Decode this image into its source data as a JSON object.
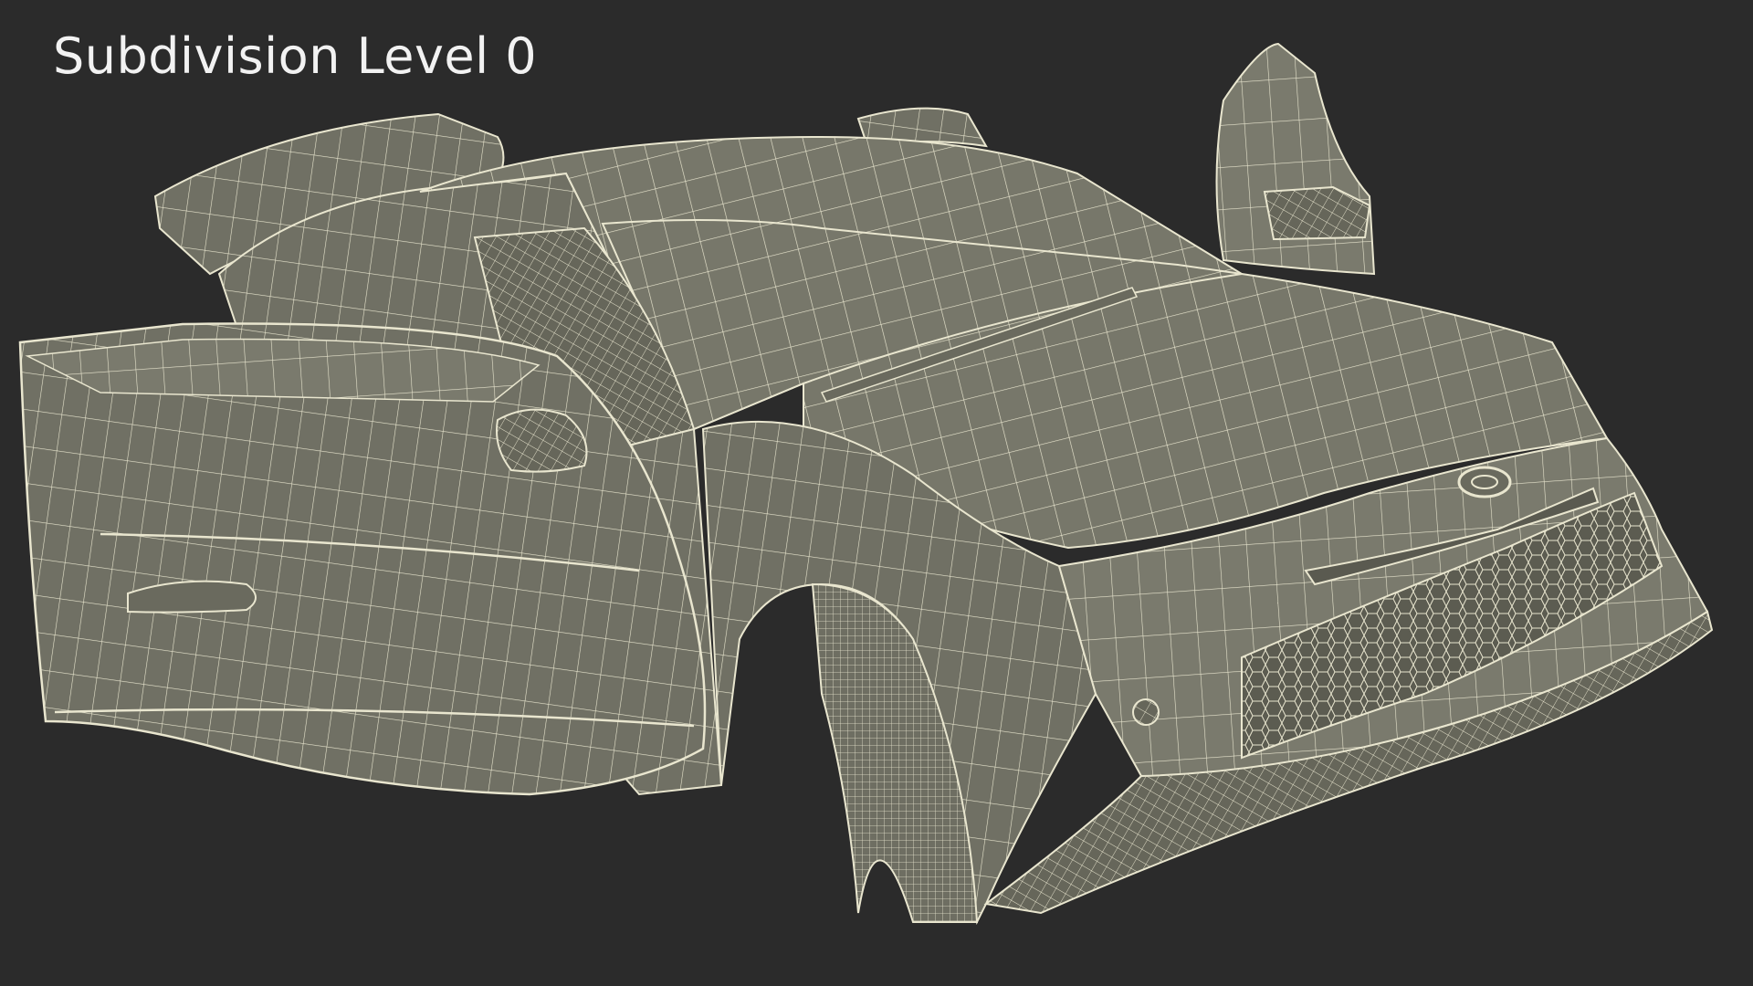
{
  "caption": {
    "text": "Subdivision Level 0"
  },
  "colors": {
    "background": "#2b2b2b",
    "surface": "#77776a",
    "surface_dark": "#626256",
    "wire": "#e9e6cf",
    "caption": "#f2f2f2"
  },
  "render": {
    "subject": "car-wireframe-model",
    "icon": "car-icon"
  }
}
